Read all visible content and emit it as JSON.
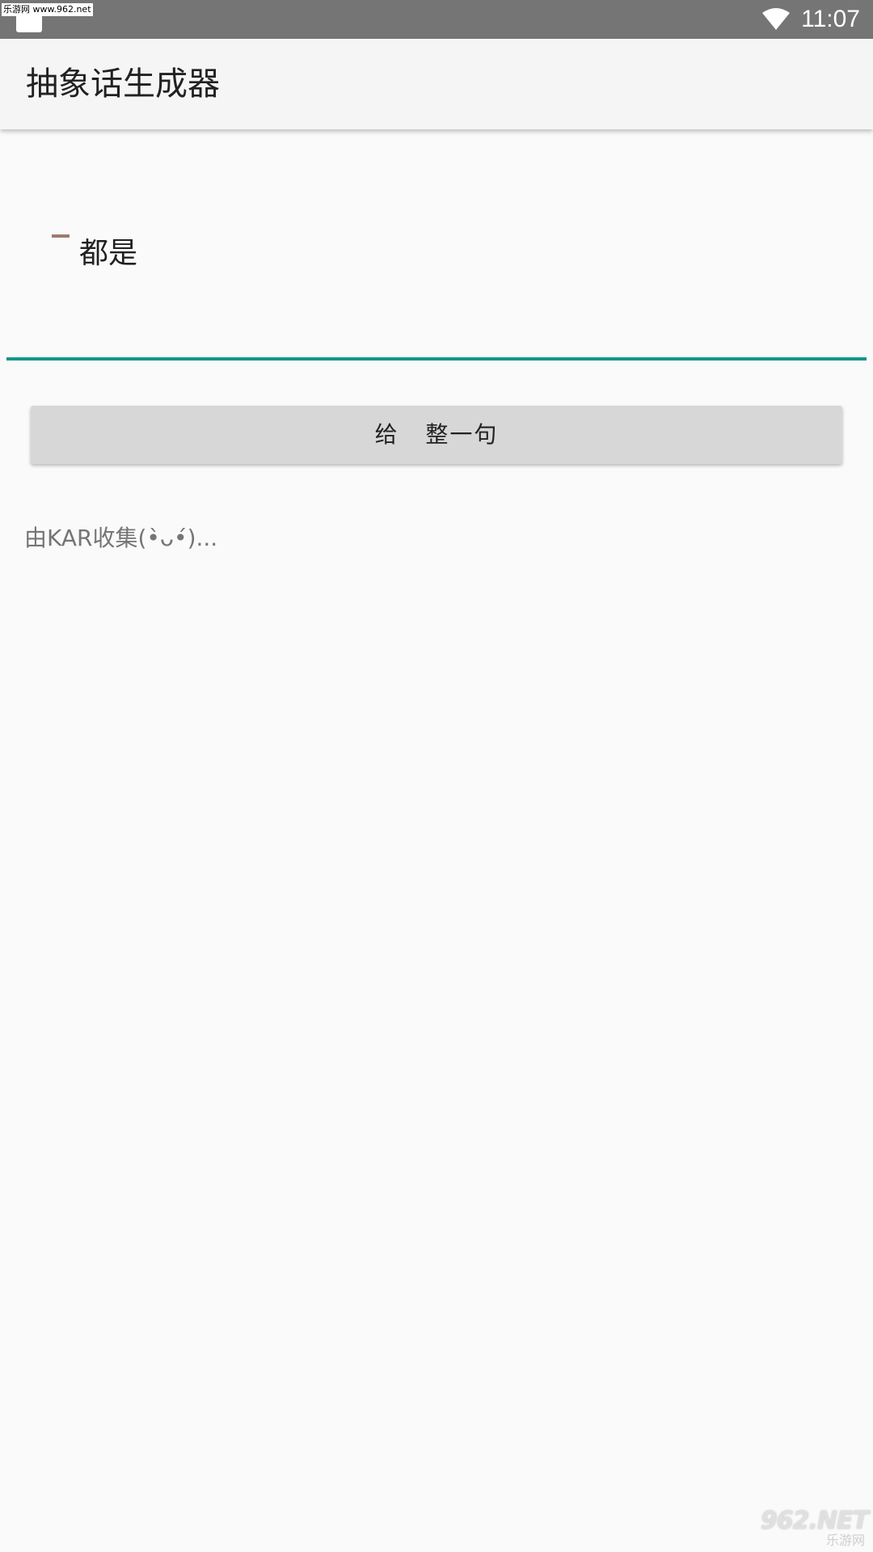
{
  "status_bar": {
    "watermark": "乐游网 www.962.net",
    "time": "11:07",
    "icons": [
      "notification-icon",
      "wifi-icon"
    ]
  },
  "app_bar": {
    "title": "抽象话生成器"
  },
  "input": {
    "value": "都是",
    "accent_color": "#159688"
  },
  "action_button": {
    "label": "给   整一句"
  },
  "footer": {
    "credit": "由KAR收集(•̀ᴗ•́)..."
  },
  "logo": {
    "top": "962.NET",
    "bottom": "乐游网"
  },
  "colors": {
    "status_bar": "#757575",
    "app_bar": "#f5f5f5",
    "background": "#fafafa",
    "button": "#d7d7d7"
  }
}
